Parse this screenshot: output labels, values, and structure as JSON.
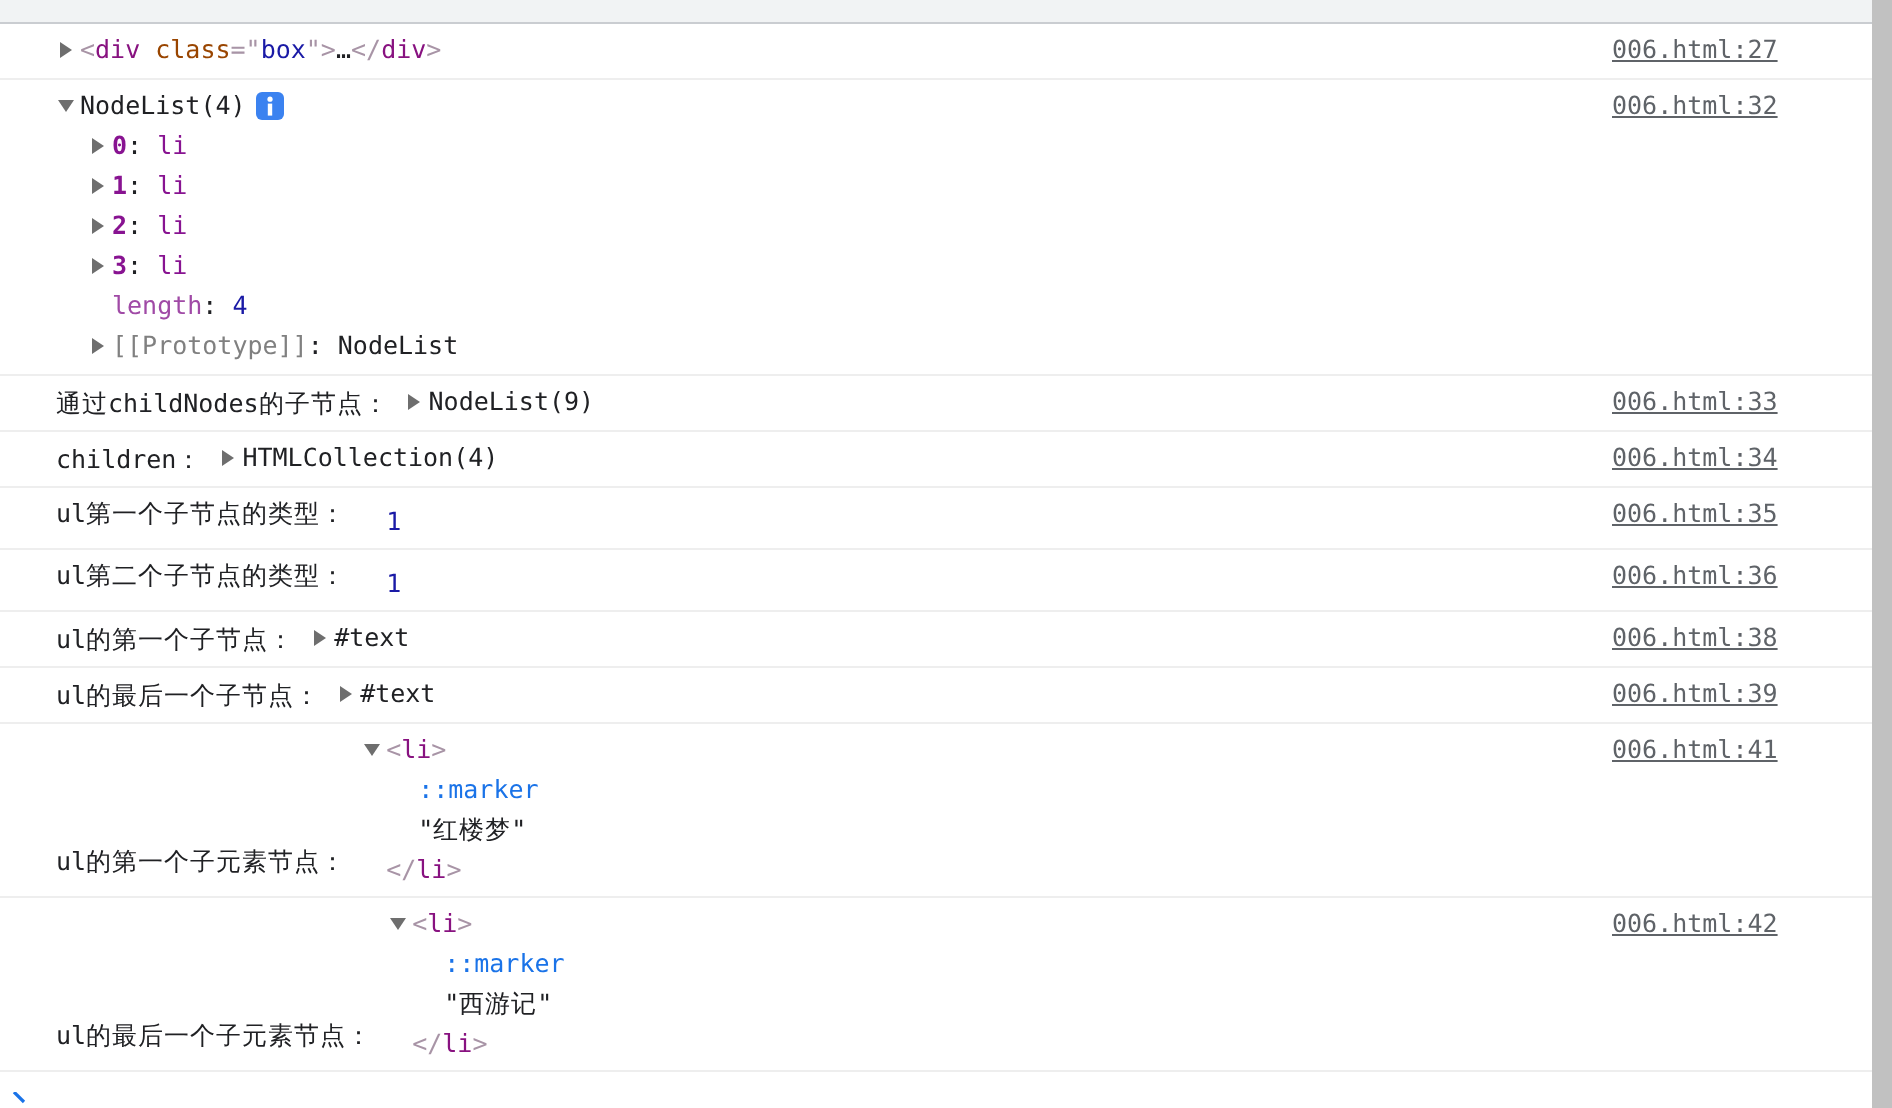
{
  "messages": [
    {
      "tree": {
        "expanded": false,
        "tokens": [
          {
            "kind": "bracket",
            "text": "<"
          },
          {
            "kind": "tag",
            "text": "div"
          },
          {
            "kind": "attr-name",
            "text": " class"
          },
          {
            "kind": "bracket",
            "text": "=\""
          },
          {
            "kind": "attr-value",
            "text": "box"
          },
          {
            "kind": "bracket",
            "text": "\">"
          },
          {
            "kind": "plain",
            "text": "…"
          },
          {
            "kind": "bracket",
            "text": "</"
          },
          {
            "kind": "tag",
            "text": "div"
          },
          {
            "kind": "bracket",
            "text": ">"
          }
        ]
      },
      "source": "006.html:27"
    },
    {
      "tree": {
        "expanded": true,
        "has_info": true,
        "tokens": [
          {
            "kind": "plain",
            "text": "NodeList(4)"
          }
        ],
        "children": [
          {
            "expanded": false,
            "tokens": [
              {
                "kind": "key",
                "text": "0"
              },
              {
                "kind": "plain",
                "text": ": "
              },
              {
                "kind": "value-name",
                "text": "li"
              }
            ]
          },
          {
            "expanded": false,
            "tokens": [
              {
                "kind": "key",
                "text": "1"
              },
              {
                "kind": "plain",
                "text": ": "
              },
              {
                "kind": "value-name",
                "text": "li"
              }
            ]
          },
          {
            "expanded": false,
            "tokens": [
              {
                "kind": "key",
                "text": "2"
              },
              {
                "kind": "plain",
                "text": ": "
              },
              {
                "kind": "value-name",
                "text": "li"
              }
            ]
          },
          {
            "expanded": false,
            "tokens": [
              {
                "kind": "key",
                "text": "3"
              },
              {
                "kind": "plain",
                "text": ": "
              },
              {
                "kind": "value-name",
                "text": "li"
              }
            ]
          },
          {
            "tokens": [
              {
                "kind": "key-dim",
                "text": "length"
              },
              {
                "kind": "plain",
                "text": ": "
              },
              {
                "kind": "number",
                "text": "4"
              }
            ]
          },
          {
            "expanded": false,
            "tokens": [
              {
                "kind": "key-proto",
                "text": "[[Prototype]]"
              },
              {
                "kind": "plain",
                "text": ": NodeList"
              }
            ]
          }
        ]
      },
      "source": "006.html:32"
    },
    {
      "label": "通过childNodes的子节点：",
      "tree": {
        "expanded": false,
        "tokens": [
          {
            "kind": "plain",
            "text": "NodeList(9)"
          }
        ]
      },
      "source": "006.html:33"
    },
    {
      "label": "children：",
      "tree": {
        "expanded": false,
        "tokens": [
          {
            "kind": "plain",
            "text": "HTMLCollection(4)"
          }
        ]
      },
      "source": "006.html:34"
    },
    {
      "label": "ul第一个子节点的类型：",
      "tree": {
        "tokens": [
          {
            "kind": "number",
            "text": "1"
          }
        ]
      },
      "source": "006.html:35"
    },
    {
      "label": "ul第二个子节点的类型：",
      "tree": {
        "tokens": [
          {
            "kind": "number",
            "text": "1"
          }
        ]
      },
      "source": "006.html:36"
    },
    {
      "label": "ul的第一个子节点：",
      "tree": {
        "expanded": false,
        "tokens": [
          {
            "kind": "plain",
            "text": "#text"
          }
        ]
      },
      "source": "006.html:38"
    },
    {
      "label": "ul的最后一个子节点：",
      "tree": {
        "expanded": false,
        "tokens": [
          {
            "kind": "plain",
            "text": "#text"
          }
        ]
      },
      "source": "006.html:39"
    },
    {
      "label": "ul的第一个子元素节点：",
      "tree": {
        "expanded": true,
        "tokens": [
          {
            "kind": "bracket",
            "text": "<"
          },
          {
            "kind": "tag",
            "text": "li"
          },
          {
            "kind": "bracket",
            "text": ">"
          }
        ],
        "children": [
          {
            "tokens": [
              {
                "kind": "pseudo",
                "text": "::marker"
              }
            ]
          },
          {
            "tokens": [
              {
                "kind": "string",
                "text": "\"红楼梦\""
              }
            ]
          }
        ],
        "closing_tokens": [
          {
            "kind": "bracket",
            "text": "</"
          },
          {
            "kind": "tag",
            "text": "li"
          },
          {
            "kind": "bracket",
            "text": ">"
          }
        ]
      },
      "source": "006.html:41"
    },
    {
      "label": "ul的最后一个子元素节点：",
      "tree": {
        "expanded": true,
        "tokens": [
          {
            "kind": "bracket",
            "text": "<"
          },
          {
            "kind": "tag",
            "text": "li"
          },
          {
            "kind": "bracket",
            "text": ">"
          }
        ],
        "children": [
          {
            "tokens": [
              {
                "kind": "pseudo",
                "text": "::marker"
              }
            ]
          },
          {
            "tokens": [
              {
                "kind": "string",
                "text": "\"西游记\""
              }
            ]
          }
        ],
        "closing_tokens": [
          {
            "kind": "bracket",
            "text": "</"
          },
          {
            "kind": "tag",
            "text": "li"
          },
          {
            "kind": "bracket",
            "text": ">"
          }
        ]
      },
      "source": "006.html:42"
    }
  ]
}
